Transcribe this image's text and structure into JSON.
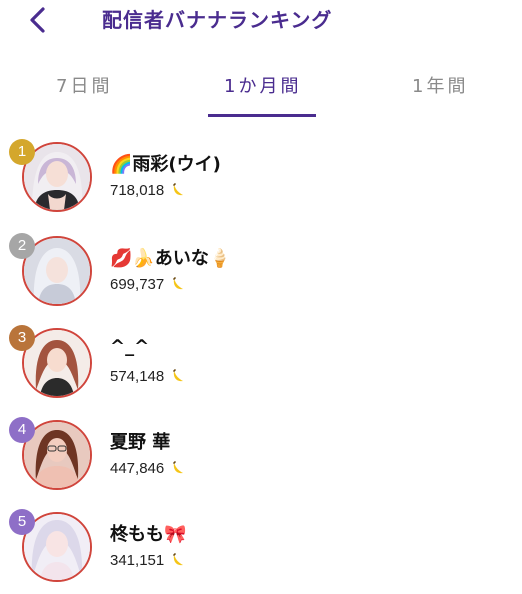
{
  "header": {
    "title": "配信者バナナランキング",
    "back_icon": "chevron-left-icon"
  },
  "tabs": [
    {
      "label": "7日間",
      "active": false
    },
    {
      "label": "1か月間",
      "active": true
    },
    {
      "label": "1年間",
      "active": false
    }
  ],
  "colors": {
    "accent": "#4a2c8f",
    "avatar_border": "#d0453c",
    "rank_1": "#d4a72c",
    "rank_2": "#a6a6a6",
    "rank_3": "#b9743a",
    "rank_4": "#8e6fc7",
    "rank_5": "#8e6fc7"
  },
  "rankings": [
    {
      "rank": "1",
      "name": "🌈雨彩(ウイ)",
      "count": "718,018",
      "icon": "banana-icon"
    },
    {
      "rank": "2",
      "name": "💋🍌あいな🍦",
      "count": "699,737",
      "icon": "banana-icon"
    },
    {
      "rank": "3",
      "name": "^_^",
      "count": "574,148",
      "icon": "banana-icon"
    },
    {
      "rank": "4",
      "name": "夏野 華",
      "count": "447,846",
      "icon": "banana-icon"
    },
    {
      "rank": "5",
      "name": "柊もも🎀",
      "count": "341,151",
      "icon": "banana-icon"
    }
  ]
}
